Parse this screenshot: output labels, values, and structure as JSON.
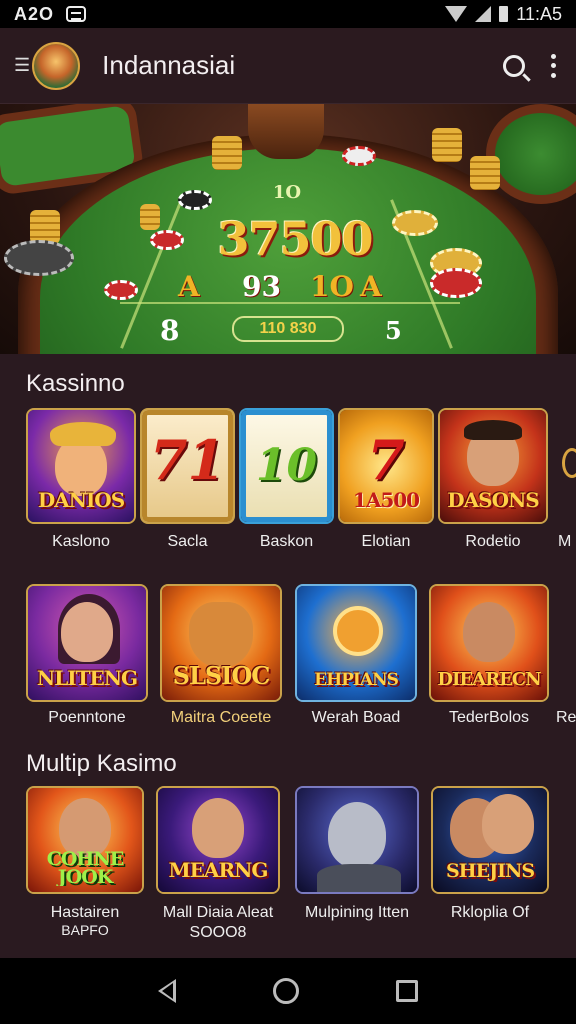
{
  "status_bar": {
    "time_left": "A2O",
    "time_right": "11:A5"
  },
  "app_bar": {
    "title": "Indannasiai",
    "icons": [
      "back-arrow-icon",
      "avatar",
      "search-icon",
      "more-vert-icon"
    ]
  },
  "hero": {
    "top_value": "1O",
    "big_value": "37500",
    "row_values": [
      "A",
      "93",
      "1O",
      "A"
    ],
    "bottom_pill": "110 830",
    "left_number": "8",
    "right_number": "5"
  },
  "sections": [
    {
      "title": "Kassinno",
      "tiles": [
        {
          "banner": "DANIOS",
          "label": "Kaslono"
        },
        {
          "banner": "",
          "big": "71",
          "label": "Sacla"
        },
        {
          "banner": "",
          "big": "10",
          "label": "Baskon"
        },
        {
          "banner": "1A500",
          "big": "7",
          "label": "Elotian"
        },
        {
          "banner": "DASONS",
          "label": "Rodetio"
        }
      ],
      "partial_label": "M"
    },
    {
      "tiles": [
        {
          "banner": "NLITENG",
          "label": "Poenntone"
        },
        {
          "banner": "SLSIOC",
          "label": "Maitra Coeete"
        },
        {
          "banner": "EHPIANS",
          "label": "Werah Boad"
        },
        {
          "banner": "DIEARECN",
          "label": "TederBolos"
        }
      ],
      "partial_label": "Re"
    },
    {
      "title": "Multip Kasimo",
      "tiles": [
        {
          "banner": "COHNE JOOK",
          "label": "Hastairen",
          "label2": "BAPFO"
        },
        {
          "banner": "MEARNG",
          "label": "Mall Diaia Aleat",
          "label2": "SOOO8"
        },
        {
          "banner": "",
          "label": "Mulpining Itten"
        },
        {
          "banner": "SHEJINS",
          "label": "Rkloplia Of"
        }
      ]
    }
  ]
}
